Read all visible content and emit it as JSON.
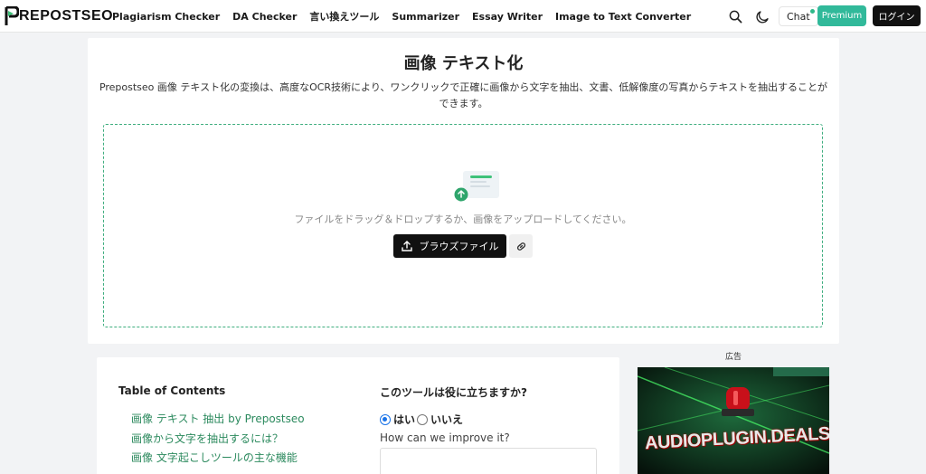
{
  "header": {
    "logo_text": "REPOSTSEO",
    "nav": [
      {
        "label": "Plagiarism Checker"
      },
      {
        "label": "DA Checker"
      },
      {
        "label": "言い換えツール"
      },
      {
        "label": "Summarizer"
      },
      {
        "label": "Essay Writer"
      },
      {
        "label": "Image to Text Converter"
      }
    ],
    "chat_label": "Chat",
    "premium_label": "Premium",
    "login_label": "ログイン",
    "icons": [
      "search-icon",
      "moon-icon"
    ],
    "colors": {
      "premium": "#31b99a",
      "login": "#111111"
    }
  },
  "tool": {
    "title": "画像 テキスト化",
    "description": "Prepostseo 画像 テキスト化の変換は、高度なOCR技術により、ワンクリックで正確に画像から文字を抽出、文書、低解像度の写真からテキストを抽出することができます。",
    "drop_text": "ファイルをドラッグ＆ドロップするか、画像をアップロードしてください。",
    "browse_label": "ブラウズファイル",
    "accent_color": "#3fae7f"
  },
  "toc": {
    "title": "Table of Contents",
    "items": [
      {
        "label": "画像 テキスト 抽出 by Prepostseo"
      },
      {
        "label": "画像から文字を抽出するには？"
      },
      {
        "label": "画像 文字起こしツールの主な機能"
      }
    ]
  },
  "feedback": {
    "title": "このツールは役に立ちますか?",
    "yes_label": "はい",
    "no_label": "いいえ",
    "selected": "yes",
    "question": "How can we improve it?"
  },
  "ad": {
    "label": "広告",
    "banner_text": "AUDIOPLUGIN.DEALS"
  }
}
